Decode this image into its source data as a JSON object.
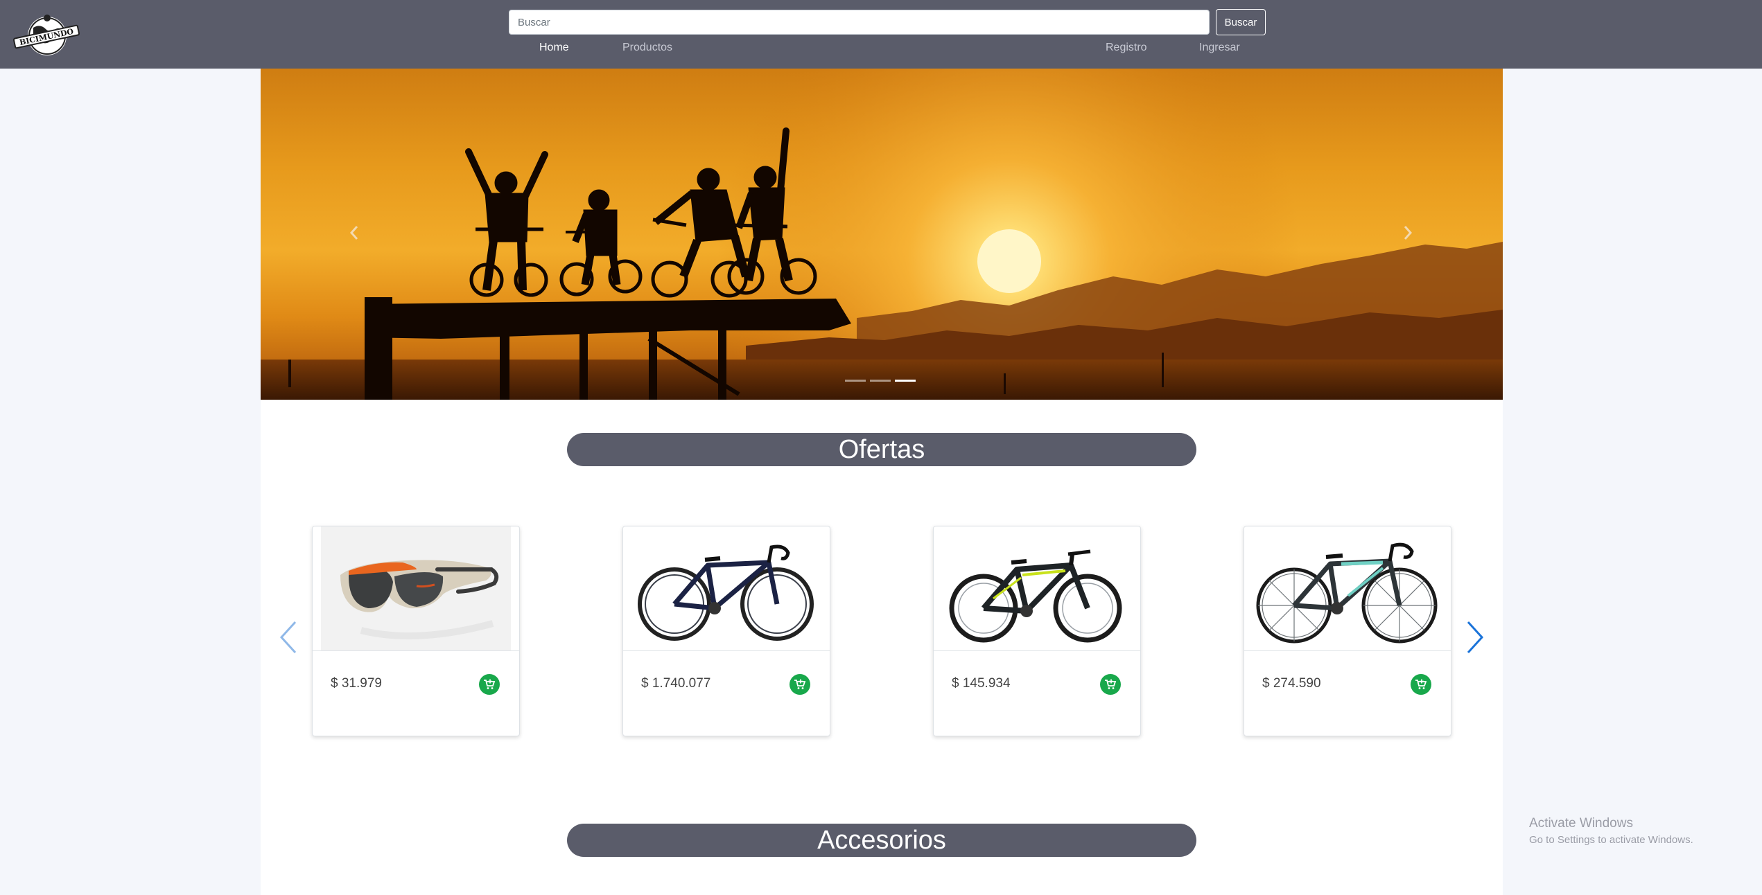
{
  "brand": {
    "logo_text": "BICIMUNDO"
  },
  "search": {
    "placeholder": "Buscar",
    "button_label": "Buscar"
  },
  "nav": {
    "home": "Home",
    "products": "Productos",
    "register": "Registro",
    "login": "Ingresar"
  },
  "carousel": {
    "slides_count": 3,
    "active_slide": 3,
    "prev_icon": "chevron-left-icon",
    "next_icon": "chevron-right-icon"
  },
  "offers": {
    "title": "Ofertas",
    "products": [
      {
        "price": "$ 31.979",
        "image": "sunglasses"
      },
      {
        "price": "$ 1.740.077",
        "image": "road-bike-dark-blue"
      },
      {
        "price": "$ 145.934",
        "image": "mountain-bike-black-yellow"
      },
      {
        "price": "$ 274.590",
        "image": "road-bike-teal"
      }
    ]
  },
  "accessories": {
    "title": "Accesorios"
  },
  "colors": {
    "navbar": "#5a5c6a",
    "accent_green": "#18a84b",
    "arrow_blue": "#1a73d9",
    "page_bg": "#f4f6fb"
  },
  "system": {
    "activate_title": "Activate Windows",
    "activate_sub": "Go to Settings to activate Windows."
  }
}
